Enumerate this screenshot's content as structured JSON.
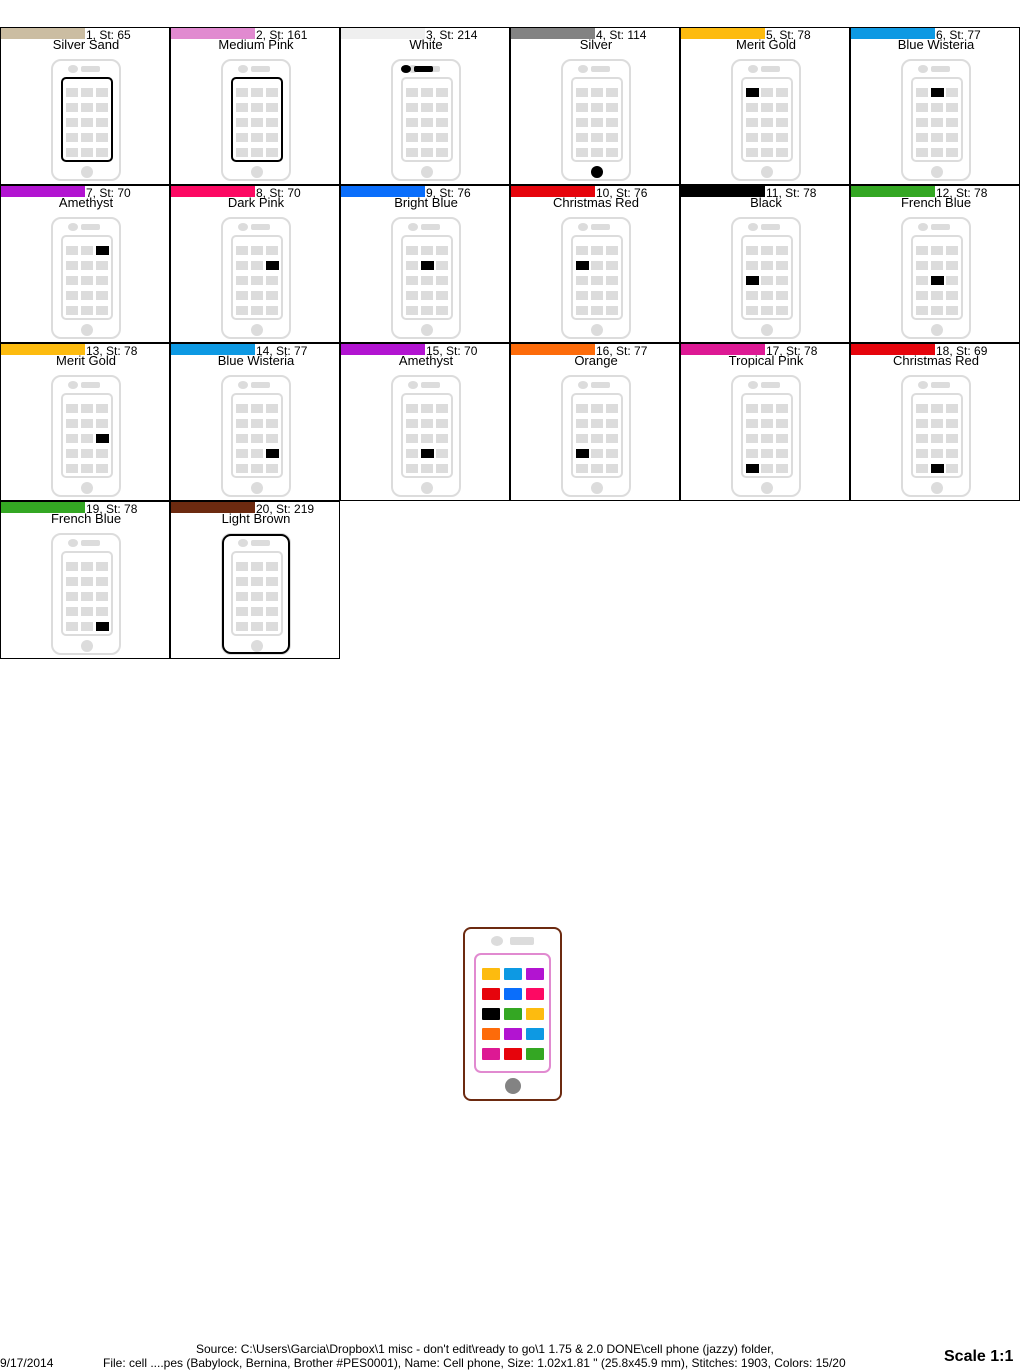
{
  "colors": [
    {
      "num": "1, St: 65",
      "name": "Silver Sand",
      "swatch": "#cbbda2",
      "mark": "outline"
    },
    {
      "num": "2, St: 161",
      "name": "Medium Pink",
      "swatch": "#e18ad0",
      "mark": "outline"
    },
    {
      "num": "3, St: 214",
      "name": "White",
      "swatch": "#efefef",
      "mark": "top-camera"
    },
    {
      "num": "4, St: 114",
      "name": "Silver",
      "swatch": "#838383",
      "mark": "home-button"
    },
    {
      "num": "5, St: 78",
      "name": "Merit Gold",
      "swatch": "#fdbb0f",
      "mark": "app",
      "row": 0,
      "col": 0
    },
    {
      "num": "6, St: 77",
      "name": "Blue Wisteria",
      "swatch": "#0d99e3",
      "mark": "app",
      "row": 0,
      "col": 1
    },
    {
      "num": "7, St: 70",
      "name": "Amethyst",
      "swatch": "#b214d1",
      "mark": "app",
      "row": 0,
      "col": 2
    },
    {
      "num": "8, St: 70",
      "name": "Dark Pink",
      "swatch": "#fd0963",
      "mark": "app",
      "row": 1,
      "col": 2
    },
    {
      "num": "9, St: 76",
      "name": "Bright Blue",
      "swatch": "#0a6efb",
      "mark": "app",
      "row": 1,
      "col": 1
    },
    {
      "num": "10, St: 76",
      "name": "Christmas Red",
      "swatch": "#e6040c",
      "mark": "app",
      "row": 1,
      "col": 0
    },
    {
      "num": "11, St: 78",
      "name": "Black",
      "swatch": "#000000",
      "mark": "app",
      "row": 2,
      "col": 0
    },
    {
      "num": "12, St: 78",
      "name": "French Blue",
      "swatch": "#34a723",
      "mark": "app",
      "row": 2,
      "col": 1
    },
    {
      "num": "13, St: 78",
      "name": "Merit Gold",
      "swatch": "#fdbb0f",
      "mark": "app",
      "row": 2,
      "col": 2
    },
    {
      "num": "14, St: 77",
      "name": "Blue Wisteria",
      "swatch": "#0d99e3",
      "mark": "app",
      "row": 3,
      "col": 2
    },
    {
      "num": "15, St: 70",
      "name": "Amethyst",
      "swatch": "#b214d1",
      "mark": "app",
      "row": 3,
      "col": 1
    },
    {
      "num": "16, St: 77",
      "name": "Orange",
      "swatch": "#fd6b0a",
      "mark": "app",
      "row": 3,
      "col": 0
    },
    {
      "num": "17, St: 78",
      "name": "Tropical Pink",
      "swatch": "#dd1994",
      "mark": "app",
      "row": 4,
      "col": 0
    },
    {
      "num": "18, St: 69",
      "name": "Christmas Red",
      "swatch": "#e6040c",
      "mark": "app",
      "row": 4,
      "col": 1
    },
    {
      "num": "19, St: 78",
      "name": "French Blue",
      "swatch": "#34a723",
      "mark": "app",
      "row": 4,
      "col": 2
    },
    {
      "num": "20, St: 219",
      "name": "Light Brown",
      "swatch": "#6c2a10",
      "mark": "outline"
    }
  ],
  "preview": {
    "app_colors": [
      [
        "#fdbb0f",
        "#0d99e3",
        "#b214d1"
      ],
      [
        "#e6040c",
        "#0a6efb",
        "#fd0963"
      ],
      [
        "#000000",
        "#34a723",
        "#fdbb0f"
      ],
      [
        "#fd6b0a",
        "#b214d1",
        "#0d99e3"
      ],
      [
        "#dd1994",
        "#e6040c",
        "#34a723"
      ]
    ],
    "outline_color": "#6c2a10",
    "screen_color": "#e18ad0",
    "home_color": "#838383"
  },
  "footer": {
    "date": "9/17/2014",
    "source": "Source: C:\\Users\\Garcia\\Dropbox\\1 misc - don't edit\\ready to go\\1 1.75 & 2.0 DONE\\cell phone (jazzy) folder,",
    "file": "File: cell ....pes (Babylock, Bernina, Brother #PES0001), Name: Cell phone, Size: 1.02x1.81 \" (25.8x45.9 mm), Stitches: 1903, Colors: 15/20",
    "scale": "Scale 1:1"
  }
}
